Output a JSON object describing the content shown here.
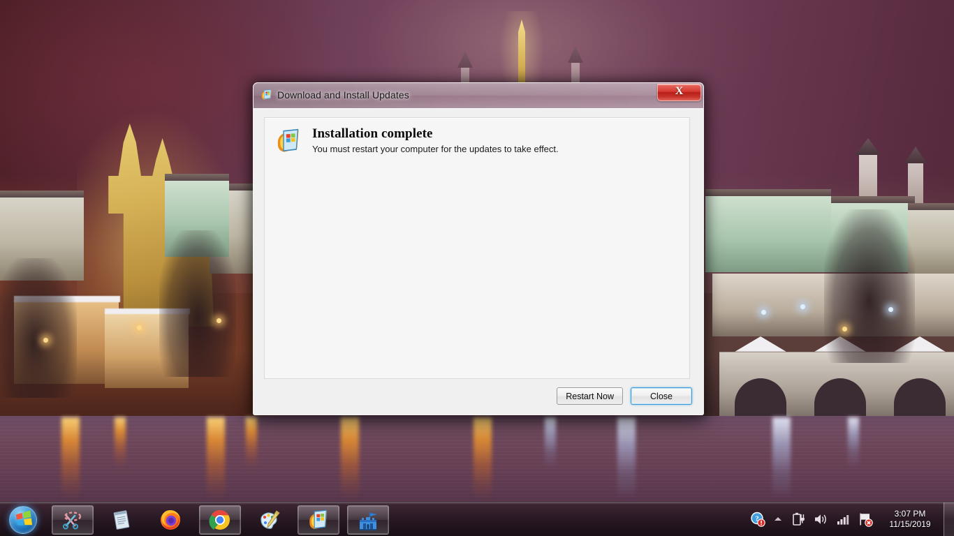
{
  "desktop": {
    "wallpaper_description": "Night view of Prague, St. Nicholas Church and Charles Bridge over the Vltava river",
    "colors": {
      "sky_purple": "#6c3d57",
      "sky_maroon": "#4e1f26",
      "water": "#6a4256",
      "lamp_warm": "#ffd98a",
      "taskbar": "#2e1c28"
    }
  },
  "dialog": {
    "title": "Download and Install Updates",
    "title_icon": "windows-update-icon",
    "close_button_label": "X",
    "content": {
      "icon": "windows-update-icon",
      "heading": "Installation complete",
      "subtext": "You must restart your computer for the updates to take effect."
    },
    "buttons": [
      {
        "label": "Restart Now",
        "name": "restart-now-button",
        "focused": false
      },
      {
        "label": "Close",
        "name": "close-button",
        "focused": true
      }
    ]
  },
  "taskbar": {
    "start_button": {
      "name": "start-button",
      "icon": "windows-logo-orb-icon"
    },
    "items": [
      {
        "name": "taskbar-item-snipping-tool",
        "icon": "snipping-tool-icon",
        "label": "Snipping Tool"
      },
      {
        "name": "taskbar-item-notepad",
        "icon": "notepad-icon",
        "label": "Notepad"
      },
      {
        "name": "taskbar-item-firefox",
        "icon": "firefox-icon",
        "label": "Mozilla Firefox"
      },
      {
        "name": "taskbar-item-chrome",
        "icon": "chrome-icon",
        "label": "Google Chrome"
      },
      {
        "name": "taskbar-item-paint",
        "icon": "paint-icon",
        "label": "Paint"
      },
      {
        "name": "taskbar-item-windows-update",
        "icon": "windows-update-icon",
        "label": "Download and Install Updates"
      },
      {
        "name": "taskbar-item-castle-app",
        "icon": "castle-icon",
        "label": "Castle"
      }
    ],
    "tray": {
      "icons": [
        {
          "name": "help-action-icon",
          "icon": "help-question-icon",
          "badge": "error"
        },
        {
          "name": "show-hidden-icons-button",
          "icon": "chevron-up-icon"
        },
        {
          "name": "power-icon",
          "icon": "battery-plug-icon"
        },
        {
          "name": "volume-icon",
          "icon": "speaker-icon"
        },
        {
          "name": "network-icon",
          "icon": "signal-bars-icon"
        },
        {
          "name": "action-center-icon",
          "icon": "flag-icon",
          "badge": "error"
        }
      ],
      "clock": {
        "time": "3:07 PM",
        "date": "11/15/2019"
      },
      "show_desktop": {
        "name": "show-desktop-button"
      }
    }
  }
}
